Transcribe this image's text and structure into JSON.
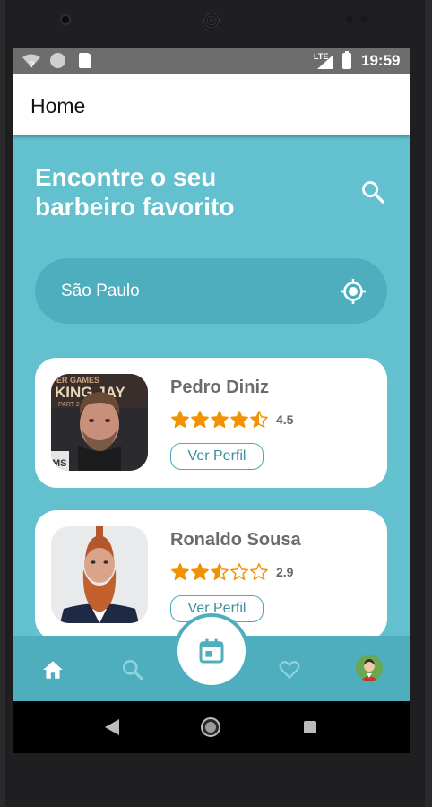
{
  "status_bar": {
    "network": "LTE",
    "time": "19:59"
  },
  "app_bar": {
    "title": "Home"
  },
  "hero": {
    "title_line1": "Encontre o seu",
    "title_line2": "barbeiro favorito",
    "search_icon": "search-icon"
  },
  "location": {
    "value": "São Paulo",
    "icon": "location-target-icon"
  },
  "barbers": [
    {
      "name": "Pedro Diniz",
      "rating": "4.5",
      "stars": 4.5,
      "button_label": "Ver Perfil"
    },
    {
      "name": "Ronaldo Sousa",
      "rating": "2.9",
      "stars": 2.5,
      "button_label": "Ver Perfil"
    }
  ],
  "bottom_nav": {
    "items": [
      "home-icon",
      "search-icon",
      "calendar-icon",
      "heart-icon",
      "user-avatar"
    ]
  },
  "colors": {
    "background": "#62c0cf",
    "accent_dark": "#4eaebe",
    "star": "#f39200",
    "white": "#ffffff"
  }
}
